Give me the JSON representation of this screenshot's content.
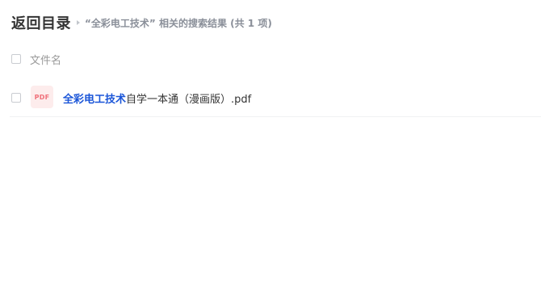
{
  "header": {
    "back_label": "返回目录",
    "search_summary": "“全彩电工技术” 相关的搜索结果 (共 1 项)"
  },
  "table": {
    "columns": [
      "文件名"
    ]
  },
  "files": [
    {
      "icon": "pdf-file-icon",
      "icon_label": "PDF",
      "name_highlight": "全彩电工技术",
      "name_rest": "自学一本通（漫画版）.pdf"
    }
  ],
  "colors": {
    "highlight": "#1a55d8",
    "pdf_icon_bg": "#fdecec",
    "pdf_icon_text": "#f0707a"
  }
}
